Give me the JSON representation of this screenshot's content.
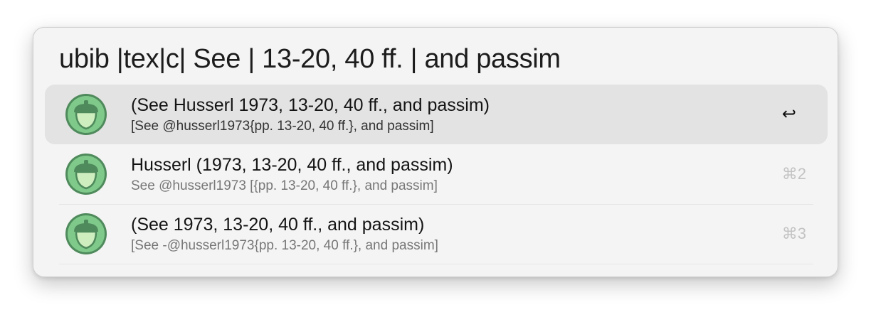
{
  "search": {
    "query": "ubib |tex|c| See | 13-20, 40 ff. | and passim"
  },
  "results": [
    {
      "title": "(See Husserl 1973, 13-20, 40 ff., and passim)",
      "subtitle": "[See @husserl1973{pp. 13-20, 40 ff.}, and passim]",
      "shortcut": "↩",
      "icon": "acorn-icon",
      "selected": true
    },
    {
      "title": "Husserl (1973, 13-20, 40 ff., and passim)",
      "subtitle": "See @husserl1973 [{pp. 13-20, 40 ff.}, and passim]",
      "shortcut": "⌘2",
      "icon": "acorn-icon",
      "selected": false
    },
    {
      "title": "(See 1973, 13-20, 40 ff., and passim)",
      "subtitle": "[See -@husserl1973{pp. 13-20, 40 ff.}, and passim]",
      "shortcut": "⌘3",
      "icon": "acorn-icon",
      "selected": false
    }
  ],
  "colors": {
    "icon_ring": "#7fc98a",
    "icon_body": "#cfeec0",
    "icon_dark": "#4f8a5c",
    "selection": "#e2e3e2"
  }
}
